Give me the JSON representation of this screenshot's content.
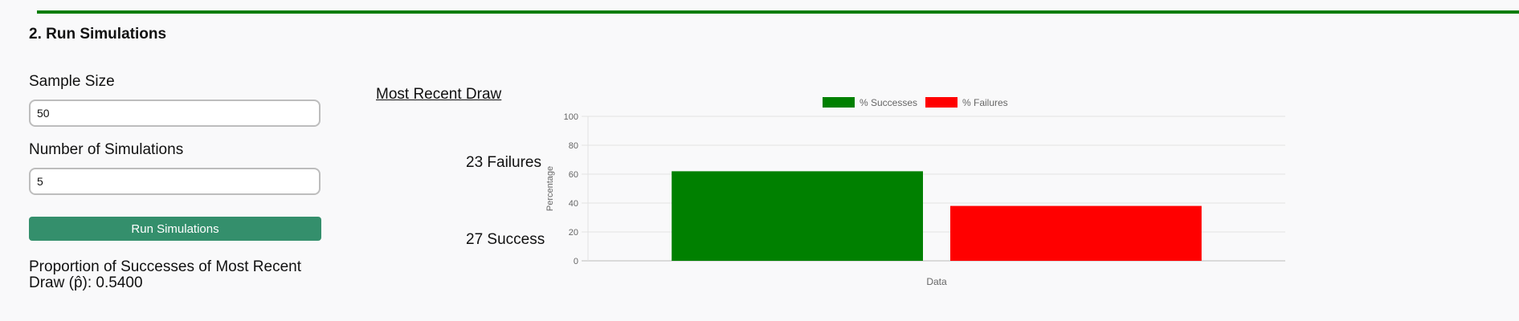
{
  "section": {
    "title": "2. Run Simulations"
  },
  "form": {
    "sample_size_label": "Sample Size",
    "sample_size_value": "50",
    "num_simulations_label": "Number of Simulations",
    "num_simulations_value": "5",
    "run_button_label": "Run Simulations"
  },
  "result": {
    "proportion_text": "Proportion of Successes of Most Recent Draw (p̂): 0.5400"
  },
  "draw": {
    "heading": "Most Recent Draw",
    "failures_text": "23 Failures",
    "successes_text": "27 Success"
  },
  "colors": {
    "accent": "#0a7d0a",
    "button": "#348f6c",
    "success": "#008000",
    "failure": "#ff0000"
  },
  "chart_data": {
    "type": "bar",
    "categories": [
      "Data"
    ],
    "series": [
      {
        "name": "% Successes",
        "values": [
          62
        ],
        "color": "#008000"
      },
      {
        "name": "% Failures",
        "values": [
          38
        ],
        "color": "#ff0000"
      }
    ],
    "xlabel": "Data",
    "ylabel": "Percentage",
    "ylim": [
      0,
      100
    ],
    "yticks": [
      0,
      20,
      40,
      60,
      80,
      100
    ],
    "grid": true,
    "legend": "top"
  }
}
